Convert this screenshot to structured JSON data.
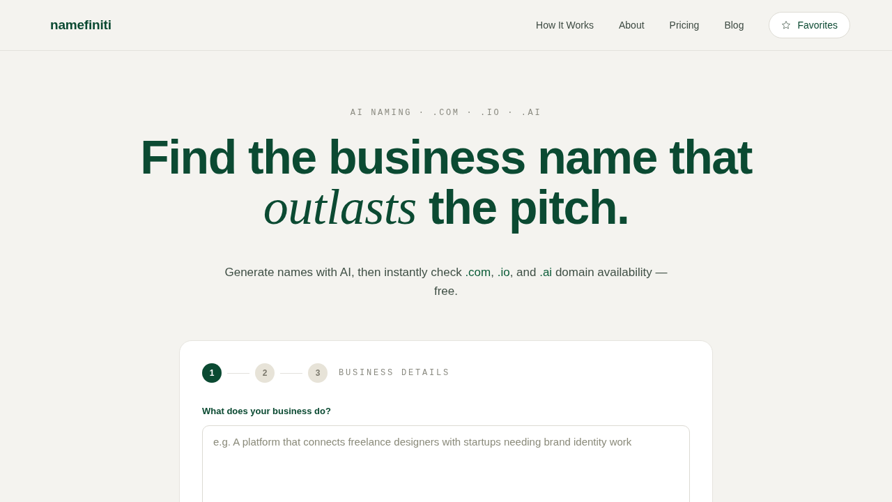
{
  "header": {
    "logo": "namefiniti",
    "nav": [
      {
        "label": "How It Works"
      },
      {
        "label": "About"
      },
      {
        "label": "Pricing"
      },
      {
        "label": "Blog"
      }
    ],
    "favorites_button": {
      "label": "Favorites"
    }
  },
  "hero": {
    "eyebrow": "AI NAMING · .COM · .IO · .AI",
    "headline": {
      "line_1": "Find the business name that",
      "emphasis": "outlasts",
      "rest": "the pitch."
    },
    "subtitle": [
      {
        "text": "Generate names with AI, then instantly check ",
        "highlight": false
      },
      {
        "text": ".com",
        "highlight": true
      },
      {
        "text": ", ",
        "highlight": false
      },
      {
        "text": ".io",
        "highlight": true
      },
      {
        "text": ", and ",
        "highlight": false
      },
      {
        "text": ".ai",
        "highlight": true
      },
      {
        "text": " domain availability — free.",
        "highlight": false
      }
    ]
  },
  "form_card": {
    "steps": [
      {
        "label": "1",
        "selected": true
      },
      {
        "label": "2",
        "selected": false
      },
      {
        "label": "3",
        "selected": false
      }
    ],
    "step_title": "BUSINESS DETAILS",
    "field": {
      "label": "What does your business do?",
      "placeholder": "e.g. A platform that connects freelance designers with startups needing brand identity work"
    }
  }
}
